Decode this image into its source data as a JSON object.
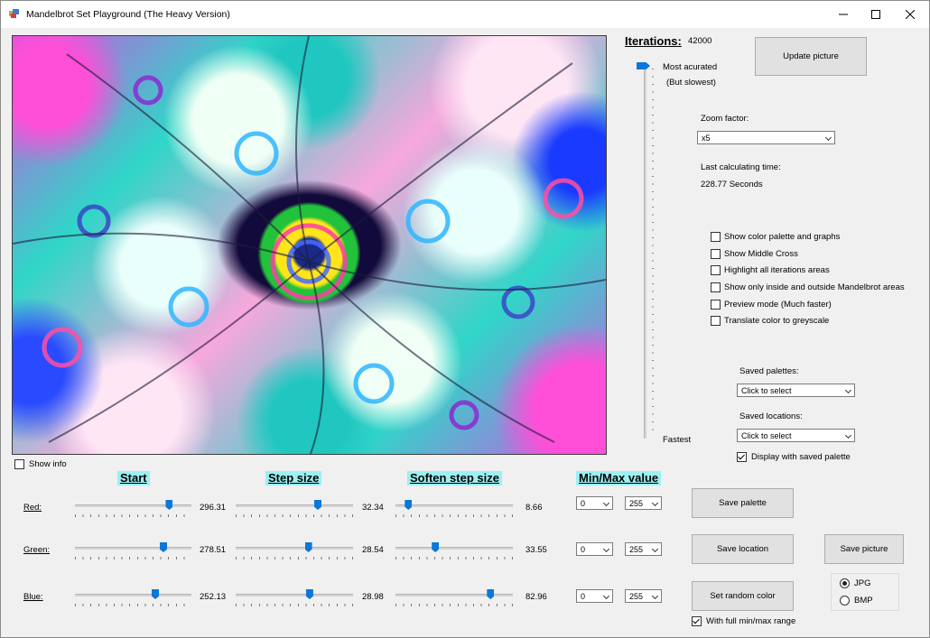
{
  "window": {
    "title": "Mandelbrot Set Playground (The Heavy Version)",
    "controls": [
      "minimize",
      "maximize",
      "close"
    ]
  },
  "iterations": {
    "label": "Iterations:",
    "value": "42000",
    "slider_top_label": "Most acurated",
    "slider_top_sublabel": "(But slowest)",
    "slider_bottom_label": "Fastest",
    "slider_level": 1.0
  },
  "update_button": "Update picture",
  "zoom": {
    "label": "Zoom factor:",
    "value": "x5"
  },
  "calc_time": {
    "label": "Last calculating time:",
    "value": "228.77 Seconds"
  },
  "options": [
    {
      "label": "Show color palette and graphs",
      "checked": false
    },
    {
      "label": "Show Middle Cross",
      "checked": false
    },
    {
      "label": "Highlight all iterations areas",
      "checked": false
    },
    {
      "label": "Show only inside and outside Mandelbrot areas",
      "checked": false
    },
    {
      "label": "Preview mode (Much faster)",
      "checked": false
    },
    {
      "label": "Translate color to greyscale",
      "checked": false
    }
  ],
  "saved_palettes": {
    "label": "Saved palettes:",
    "value": "Click to select"
  },
  "saved_locations": {
    "label": "Saved locations:",
    "value": "Click to select"
  },
  "display_saved_palette": {
    "label": "Display with saved palette",
    "checked": true
  },
  "show_info": {
    "label": "Show info",
    "checked": false
  },
  "headers": {
    "start": "Start",
    "step": "Step size",
    "soften": "Soften step size",
    "minmax": "Min/Max value"
  },
  "channels": [
    {
      "label": "Red:",
      "start": {
        "value": "296.31",
        "level": 0.81
      },
      "step": {
        "value": "32.34",
        "level": 0.7
      },
      "soften": {
        "value": "8.66",
        "level": 0.11
      },
      "min": "0",
      "max": "255"
    },
    {
      "label": "Green:",
      "start": {
        "value": "278.51",
        "level": 0.76
      },
      "step": {
        "value": "28.54",
        "level": 0.62
      },
      "soften": {
        "value": "33.55",
        "level": 0.34
      },
      "min": "0",
      "max": "255"
    },
    {
      "label": "Blue:",
      "start": {
        "value": "252.13",
        "level": 0.69
      },
      "step": {
        "value": "28.98",
        "level": 0.63
      },
      "soften": {
        "value": "82.96",
        "level": 0.81
      },
      "min": "0",
      "max": "255"
    }
  ],
  "buttons": {
    "save_palette": "Save  palette",
    "save_location": "Save location",
    "save_picture": "Save picture",
    "random_color": "Set random color"
  },
  "full_range": {
    "label": "With full min/max range",
    "checked": true
  },
  "format": {
    "options": [
      "JPG",
      "BMP"
    ],
    "selected": "JPG"
  },
  "colors": {
    "accent": "#0a78d7",
    "header_bg": "#9bf0f2",
    "window_bg": "#f0f0f0"
  }
}
